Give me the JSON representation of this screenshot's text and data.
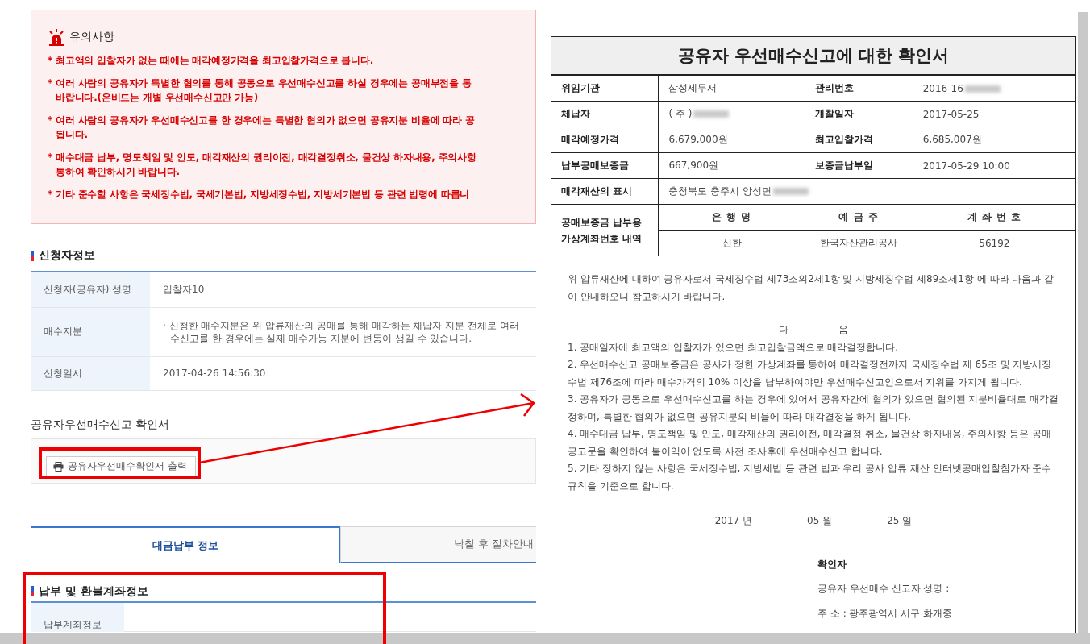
{
  "notice": {
    "title": "유의사항",
    "items": [
      {
        "lines": [
          "* 최고액의 입찰자가 없는 때에는 매각예정가격을 최고입찰가격으로 봅니다."
        ]
      },
      {
        "lines": [
          "* 여러 사람의 공유자가 특별한 협의를 통해 공동으로 우선매수신고를 하실 경우에는 공매부점을 통",
          "바랍니다.(온비드는 개별 우선매수신고만 가능)"
        ]
      },
      {
        "lines": [
          "* 여러 사람의 공유자가 우선매수신고를 한 경우에는 특별한 협의가 없으면 공유지분 비율에 따라 공",
          "됩니다."
        ]
      },
      {
        "lines": [
          "* 매수대금 납부, 명도책임 및 인도, 매각재산의 권리이전, 매각결정취소, 물건상 하자내용, 주의사항",
          "통하여 확인하시기 바랍니다."
        ]
      },
      {
        "lines": [
          "* 기타 준수할 사항은 국세징수법, 국세기본법, 지방세징수법, 지방세기본법 등 관련 법령에 따릅니"
        ]
      }
    ]
  },
  "applicant": {
    "title": "신청자정보",
    "rows": [
      {
        "label": "신청자(공유자) 성명",
        "lines": [
          "입찰자10"
        ]
      },
      {
        "label": "매수지분",
        "lines": [
          "· 신청한 매수지분은 위 압류재산의 공매를 통해 매각하는 체납자 지분 전체로 여러",
          "수신고를 한 경우에는 실제 매수가능 지분에 변동이 생길 수 있습니다."
        ]
      },
      {
        "label": "신청일시",
        "lines": [
          "2017-04-26 14:56:30"
        ]
      }
    ]
  },
  "certificate": {
    "title": "공유자우선매수신고 확인서",
    "button": "공유자우선매수확인서 출력"
  },
  "tabs": [
    {
      "label": "대금납부 정보",
      "selected": true
    },
    {
      "label": "낙찰 후 절차안내",
      "selected": false
    }
  ],
  "account": {
    "title": "납부 및 환불계좌정보",
    "rows": [
      {
        "label": "납부계좌정보"
      }
    ]
  },
  "document": {
    "title": "공유자 우선매수신고에 대한 확인서",
    "rows": [
      {
        "label": "위임기관",
        "value": "삼성세무서",
        "redacted": false,
        "label_2": "관리번호",
        "value_2": "2016-16",
        "redacted_2": true
      },
      {
        "label": "체납자",
        "value": "( 주 )",
        "redacted": true,
        "label_2": "개찰일자",
        "value_2": "2017-05-25",
        "redacted_2": false
      },
      {
        "label": "매각예정가격",
        "value": "6,679,000원",
        "redacted": false,
        "label_2": "최고입찰가격",
        "value_2": "6,685,007원",
        "redacted_2": false
      },
      {
        "label": "납부공매보증금",
        "value": "667,900원",
        "redacted": false,
        "label_2": "보증금납부일",
        "value_2": "2017-05-29 10:00",
        "redacted_2": false
      },
      {
        "label": "매각재산의 표시",
        "value": "충청북도 충주시 앙성면",
        "redacted": true
      }
    ],
    "bank": {
      "label_lines": [
        "공매보증금 납부용",
        "가상계좌번호 내역"
      ],
      "columns": [
        "은 행 명",
        "예 금 주",
        "계 좌 번 호"
      ],
      "values": [
        "신한",
        "한국자산관리공사",
        "56192"
      ]
    },
    "intro": "위 압류재산에 대하여 공유자로서 국세징수법 제73조의2제1항 및 지방세징수법 제89조제1항 에 따라 다음과 같이 안내하오니 참고하시기 바랍니다.",
    "heading": [
      "- 다",
      "음 -"
    ],
    "items": [
      "1. 공매일자에 최고액의 입찰자가 있으면 최고입찰금액으로 매각결정합니다.",
      "2. 우선매수신고 공매보증금은 공사가 정한 가상계좌를 통하여 매각결정전까지 국세징수법 제 65조 및 지방세징수법 제76조에 따라 매수가격의 10% 이상을 납부하여야만 우선매수신고인으로서 지위를 가지게 됩니다.",
      "3. 공유자가 공동으로 우선매수신고를 하는 경우에 있어서 공유자간에 협의가 있으면 협의된 지분비율대로 매각결정하며, 특별한 협의가 없으면 공유지분의 비율에 따라 매각결정을 하게 됩니다.",
      "4. 매수대금 납부, 명도책임 및 인도, 매각재산의 권리이전, 매각결정 취소, 물건상 하자내용, 주의사항 등은 공매공고문을 확인하여 불이익이 없도록 사전 조사후에 우선매수신고 합니다.",
      "5. 기타 정하지 않는 사항은 국세징수법, 지방세법 등 관련 법과 우리 공사 압류 재산 인터넷공매입찰참가자 준수규칙을 기준으로 합니다."
    ],
    "date": [
      "2017 년",
      "05 월",
      "25 일"
    ],
    "signer_title": "확인자",
    "signer_lines": [
      "공유자 우선매수 신고자 성명 :",
      "주 소 : 광주광역시 서구 화개중"
    ]
  }
}
